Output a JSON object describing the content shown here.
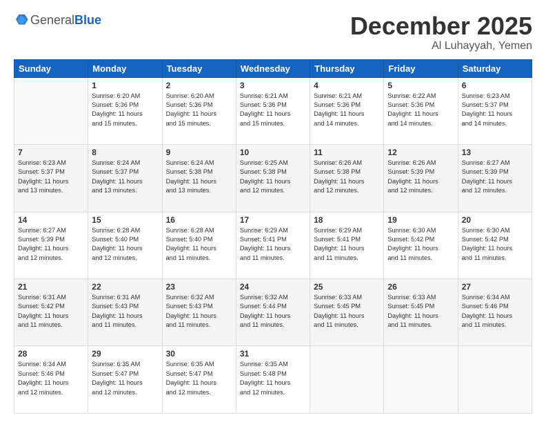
{
  "header": {
    "logo_general": "General",
    "logo_blue": "Blue",
    "month_title": "December 2025",
    "location": "Al Luhayyah, Yemen"
  },
  "days_of_week": [
    "Sunday",
    "Monday",
    "Tuesday",
    "Wednesday",
    "Thursday",
    "Friday",
    "Saturday"
  ],
  "weeks": [
    [
      {
        "day": "",
        "info": ""
      },
      {
        "day": "1",
        "info": "Sunrise: 6:20 AM\nSunset: 5:36 PM\nDaylight: 11 hours\nand 15 minutes."
      },
      {
        "day": "2",
        "info": "Sunrise: 6:20 AM\nSunset: 5:36 PM\nDaylight: 11 hours\nand 15 minutes."
      },
      {
        "day": "3",
        "info": "Sunrise: 6:21 AM\nSunset: 5:36 PM\nDaylight: 11 hours\nand 15 minutes."
      },
      {
        "day": "4",
        "info": "Sunrise: 6:21 AM\nSunset: 5:36 PM\nDaylight: 11 hours\nand 14 minutes."
      },
      {
        "day": "5",
        "info": "Sunrise: 6:22 AM\nSunset: 5:36 PM\nDaylight: 11 hours\nand 14 minutes."
      },
      {
        "day": "6",
        "info": "Sunrise: 6:23 AM\nSunset: 5:37 PM\nDaylight: 11 hours\nand 14 minutes."
      }
    ],
    [
      {
        "day": "7",
        "info": "Sunrise: 6:23 AM\nSunset: 5:37 PM\nDaylight: 11 hours\nand 13 minutes."
      },
      {
        "day": "8",
        "info": "Sunrise: 6:24 AM\nSunset: 5:37 PM\nDaylight: 11 hours\nand 13 minutes."
      },
      {
        "day": "9",
        "info": "Sunrise: 6:24 AM\nSunset: 5:38 PM\nDaylight: 11 hours\nand 13 minutes."
      },
      {
        "day": "10",
        "info": "Sunrise: 6:25 AM\nSunset: 5:38 PM\nDaylight: 11 hours\nand 12 minutes."
      },
      {
        "day": "11",
        "info": "Sunrise: 6:26 AM\nSunset: 5:38 PM\nDaylight: 11 hours\nand 12 minutes."
      },
      {
        "day": "12",
        "info": "Sunrise: 6:26 AM\nSunset: 5:39 PM\nDaylight: 11 hours\nand 12 minutes."
      },
      {
        "day": "13",
        "info": "Sunrise: 6:27 AM\nSunset: 5:39 PM\nDaylight: 11 hours\nand 12 minutes."
      }
    ],
    [
      {
        "day": "14",
        "info": "Sunrise: 6:27 AM\nSunset: 5:39 PM\nDaylight: 11 hours\nand 12 minutes."
      },
      {
        "day": "15",
        "info": "Sunrise: 6:28 AM\nSunset: 5:40 PM\nDaylight: 11 hours\nand 12 minutes."
      },
      {
        "day": "16",
        "info": "Sunrise: 6:28 AM\nSunset: 5:40 PM\nDaylight: 11 hours\nand 11 minutes."
      },
      {
        "day": "17",
        "info": "Sunrise: 6:29 AM\nSunset: 5:41 PM\nDaylight: 11 hours\nand 11 minutes."
      },
      {
        "day": "18",
        "info": "Sunrise: 6:29 AM\nSunset: 5:41 PM\nDaylight: 11 hours\nand 11 minutes."
      },
      {
        "day": "19",
        "info": "Sunrise: 6:30 AM\nSunset: 5:42 PM\nDaylight: 11 hours\nand 11 minutes."
      },
      {
        "day": "20",
        "info": "Sunrise: 6:30 AM\nSunset: 5:42 PM\nDaylight: 11 hours\nand 11 minutes."
      }
    ],
    [
      {
        "day": "21",
        "info": "Sunrise: 6:31 AM\nSunset: 5:42 PM\nDaylight: 11 hours\nand 11 minutes."
      },
      {
        "day": "22",
        "info": "Sunrise: 6:31 AM\nSunset: 5:43 PM\nDaylight: 11 hours\nand 11 minutes."
      },
      {
        "day": "23",
        "info": "Sunrise: 6:32 AM\nSunset: 5:43 PM\nDaylight: 11 hours\nand 11 minutes."
      },
      {
        "day": "24",
        "info": "Sunrise: 6:32 AM\nSunset: 5:44 PM\nDaylight: 11 hours\nand 11 minutes."
      },
      {
        "day": "25",
        "info": "Sunrise: 6:33 AM\nSunset: 5:45 PM\nDaylight: 11 hours\nand 11 minutes."
      },
      {
        "day": "26",
        "info": "Sunrise: 6:33 AM\nSunset: 5:45 PM\nDaylight: 11 hours\nand 11 minutes."
      },
      {
        "day": "27",
        "info": "Sunrise: 6:34 AM\nSunset: 5:46 PM\nDaylight: 11 hours\nand 11 minutes."
      }
    ],
    [
      {
        "day": "28",
        "info": "Sunrise: 6:34 AM\nSunset: 5:46 PM\nDaylight: 11 hours\nand 12 minutes."
      },
      {
        "day": "29",
        "info": "Sunrise: 6:35 AM\nSunset: 5:47 PM\nDaylight: 11 hours\nand 12 minutes."
      },
      {
        "day": "30",
        "info": "Sunrise: 6:35 AM\nSunset: 5:47 PM\nDaylight: 11 hours\nand 12 minutes."
      },
      {
        "day": "31",
        "info": "Sunrise: 6:35 AM\nSunset: 5:48 PM\nDaylight: 11 hours\nand 12 minutes."
      },
      {
        "day": "",
        "info": ""
      },
      {
        "day": "",
        "info": ""
      },
      {
        "day": "",
        "info": ""
      }
    ]
  ]
}
